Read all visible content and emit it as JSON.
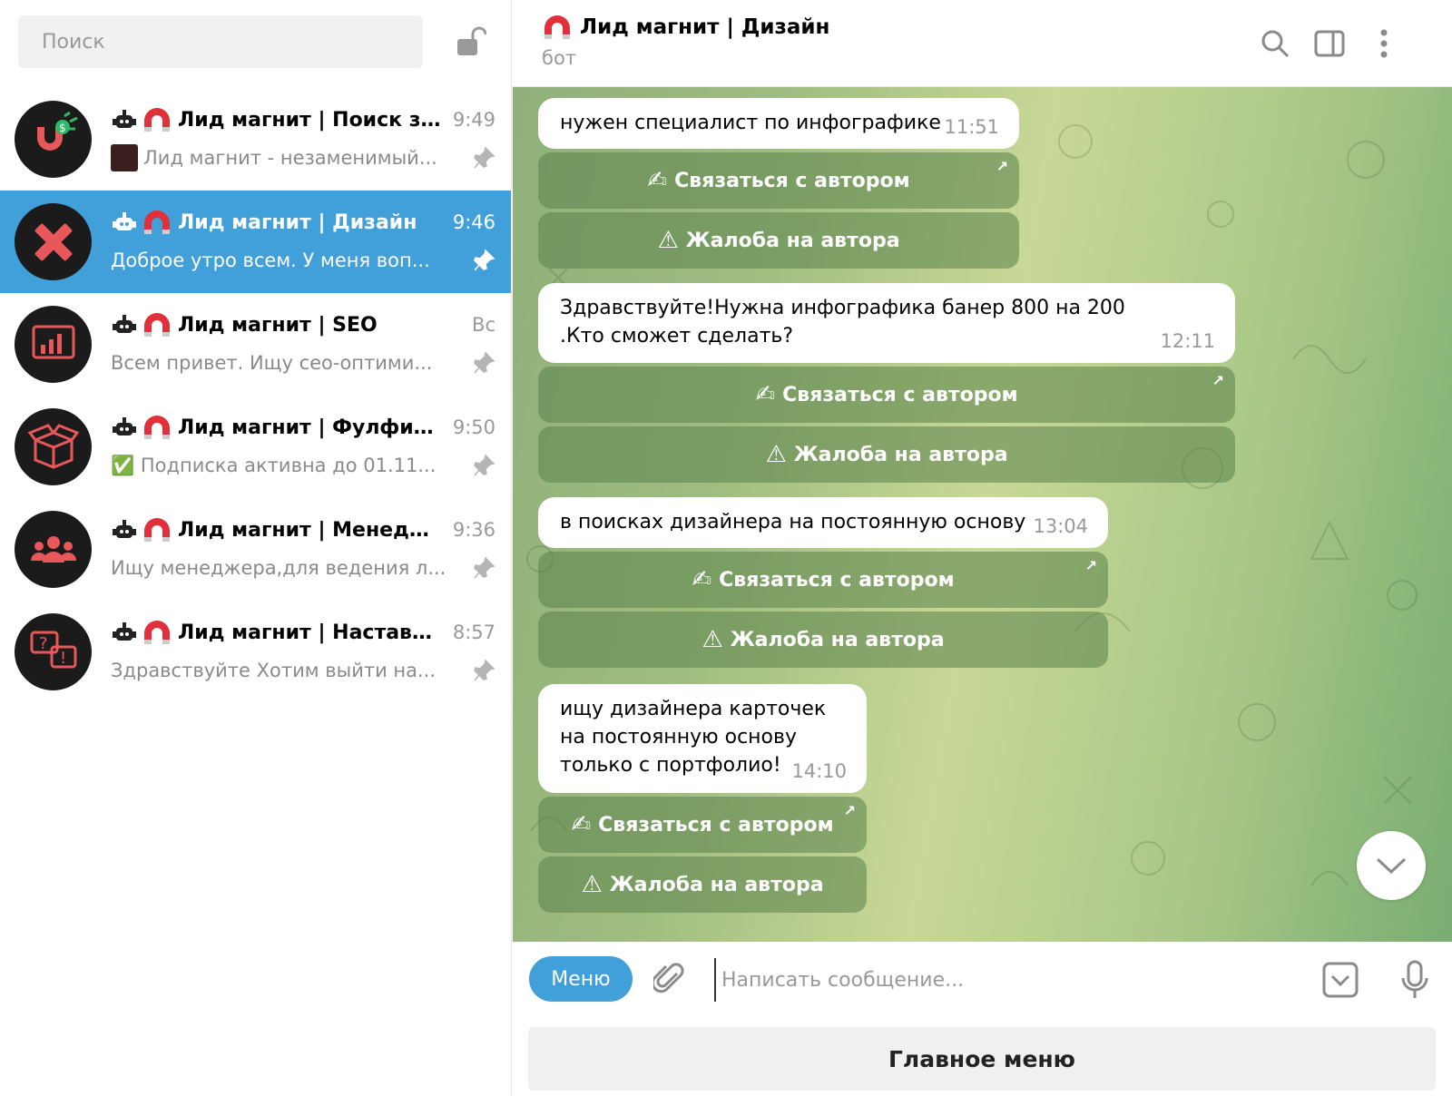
{
  "sidebar": {
    "search_placeholder": "Поиск",
    "chats": [
      {
        "name": "Лид магнит | Поиск з...",
        "time": "9:49",
        "preview": "Лид магнит - незаменимый...",
        "avatar_icon": "magnet-icon",
        "preview_thumb": true
      },
      {
        "name": "Лид магнит | Дизайн",
        "time": "9:46",
        "preview": "Доброе утро всем. У меня воп...",
        "avatar_icon": "pencil-ruler-icon",
        "active": true
      },
      {
        "name": "Лид магнит | SEO",
        "time": "Вс",
        "preview": "Всем привет. Ищу сео-оптими...",
        "avatar_icon": "chart-icon"
      },
      {
        "name": "Лид магнит | Фулфил...",
        "time": "9:50",
        "preview": "✅ Подписка активна до 01.11...",
        "avatar_icon": "box-icon"
      },
      {
        "name": "Лид магнит | Менедж...",
        "time": "9:36",
        "preview": "Ищу менеджера,для ведения л...",
        "avatar_icon": "team-icon"
      },
      {
        "name": "Лид магнит | Наставн...",
        "time": "8:57",
        "preview": "Здравствуйте  Хотим выйти на...",
        "avatar_icon": "question-chat-icon"
      }
    ]
  },
  "header": {
    "title": "Лид магнит | Дизайн",
    "subtitle": "бот"
  },
  "messages": [
    {
      "text": "нужен специалист по инфографике",
      "time": "11:51",
      "buttons": [
        "Связаться с автором",
        "Жалоба на автора"
      ]
    },
    {
      "text": "Здравствуйте!Нужна инфографика банер 800 на 200 .Кто сможет сделать?",
      "time": "12:11",
      "buttons": [
        "Связаться с автором",
        "Жалоба на автора"
      ]
    },
    {
      "text": "в поисках дизайнера на постоянную основу",
      "time": "13:04",
      "buttons": [
        "Связаться с автором",
        "Жалоба на автора"
      ]
    },
    {
      "text": "ищу дизайнера карточек на постоянную основу только с портфолио!",
      "time": "14:10",
      "buttons": [
        "Связаться с автором",
        "Жалоба на автора"
      ]
    }
  ],
  "composer": {
    "menu_label": "Меню",
    "placeholder": "Написать сообщение..."
  },
  "bottom": {
    "main_menu_label": "Главное меню"
  },
  "colors": {
    "accent": "#419fd9",
    "avatar_bg": "#1b1b1b",
    "avatar_icon": "#e8575a"
  }
}
